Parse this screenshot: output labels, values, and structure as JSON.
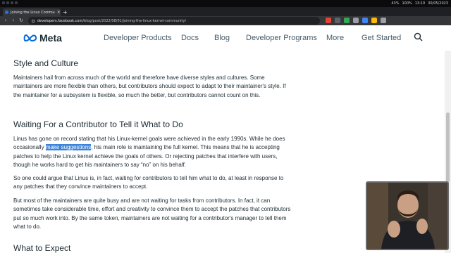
{
  "os_bar": {
    "status": [
      "43%",
      "100%",
      "13:10",
      "30/05/2023"
    ]
  },
  "browser": {
    "tab_title": "Joining the Linux Commu",
    "tab_close": "×",
    "new_tab": "+",
    "back": "‹",
    "forward": "›",
    "reload": "↻",
    "url_host": "developers.facebook.com",
    "url_path": "/blog/post/2022/08/01/joining-the-linux-kernel-community/",
    "extension_colors": [
      "#e94235",
      "#5f6368",
      "#34a853",
      "#9aa0a6",
      "#4285f4",
      "#fbbc04",
      "#9aa0a6"
    ]
  },
  "site": {
    "logo_text": "Meta",
    "nav": [
      "Developer Products",
      "Docs",
      "Blog",
      "Developer Programs",
      "More",
      "Get Started"
    ],
    "search_icon": "search-icon",
    "brand_color": "#0668e1"
  },
  "article": {
    "h1": "Style and Culture",
    "p1": "Maintainers hail from across much of the world and therefore have diverse styles and cultures. Some maintainers are more flexible than others, but contributors should expect to adapt to their maintainer's style. If the maintainer for a subsystem is flexible, so much the better, but contributors cannot count on this.",
    "h2": "Waiting For a Contributor to Tell it What to Do",
    "p2_before": "Linus has gone on record stating that his Linux-kernel goals were achieved in the early 1990s. While he does occasionally ",
    "p2_highlight": "make suggestions",
    "p2_after": ", his main role is maintaining the full kernel. This means that he is accepting patches to help the Linux kernel achieve the goals of others. Or rejecting patches that interfere with users, though he works hard to get his maintainers to say “no” on his behalf.",
    "p3": "So one could argue that Linus is, in fact, waiting for contributors to tell him what to do, at least in response to any patches that they convince maintainers to accept.",
    "p4": "But most of the maintainers are quite busy and are not waiting for tasks from contributors. In fact, it can sometimes take considerable time, effort and creativity to convince them to accept the patches that contributors put so much work into. By the same token, maintainers are not waiting for a contributor's manager to tell them what to do.",
    "h3": "What to Expect"
  },
  "webcam": {
    "icon": "webcam-video-icon"
  }
}
